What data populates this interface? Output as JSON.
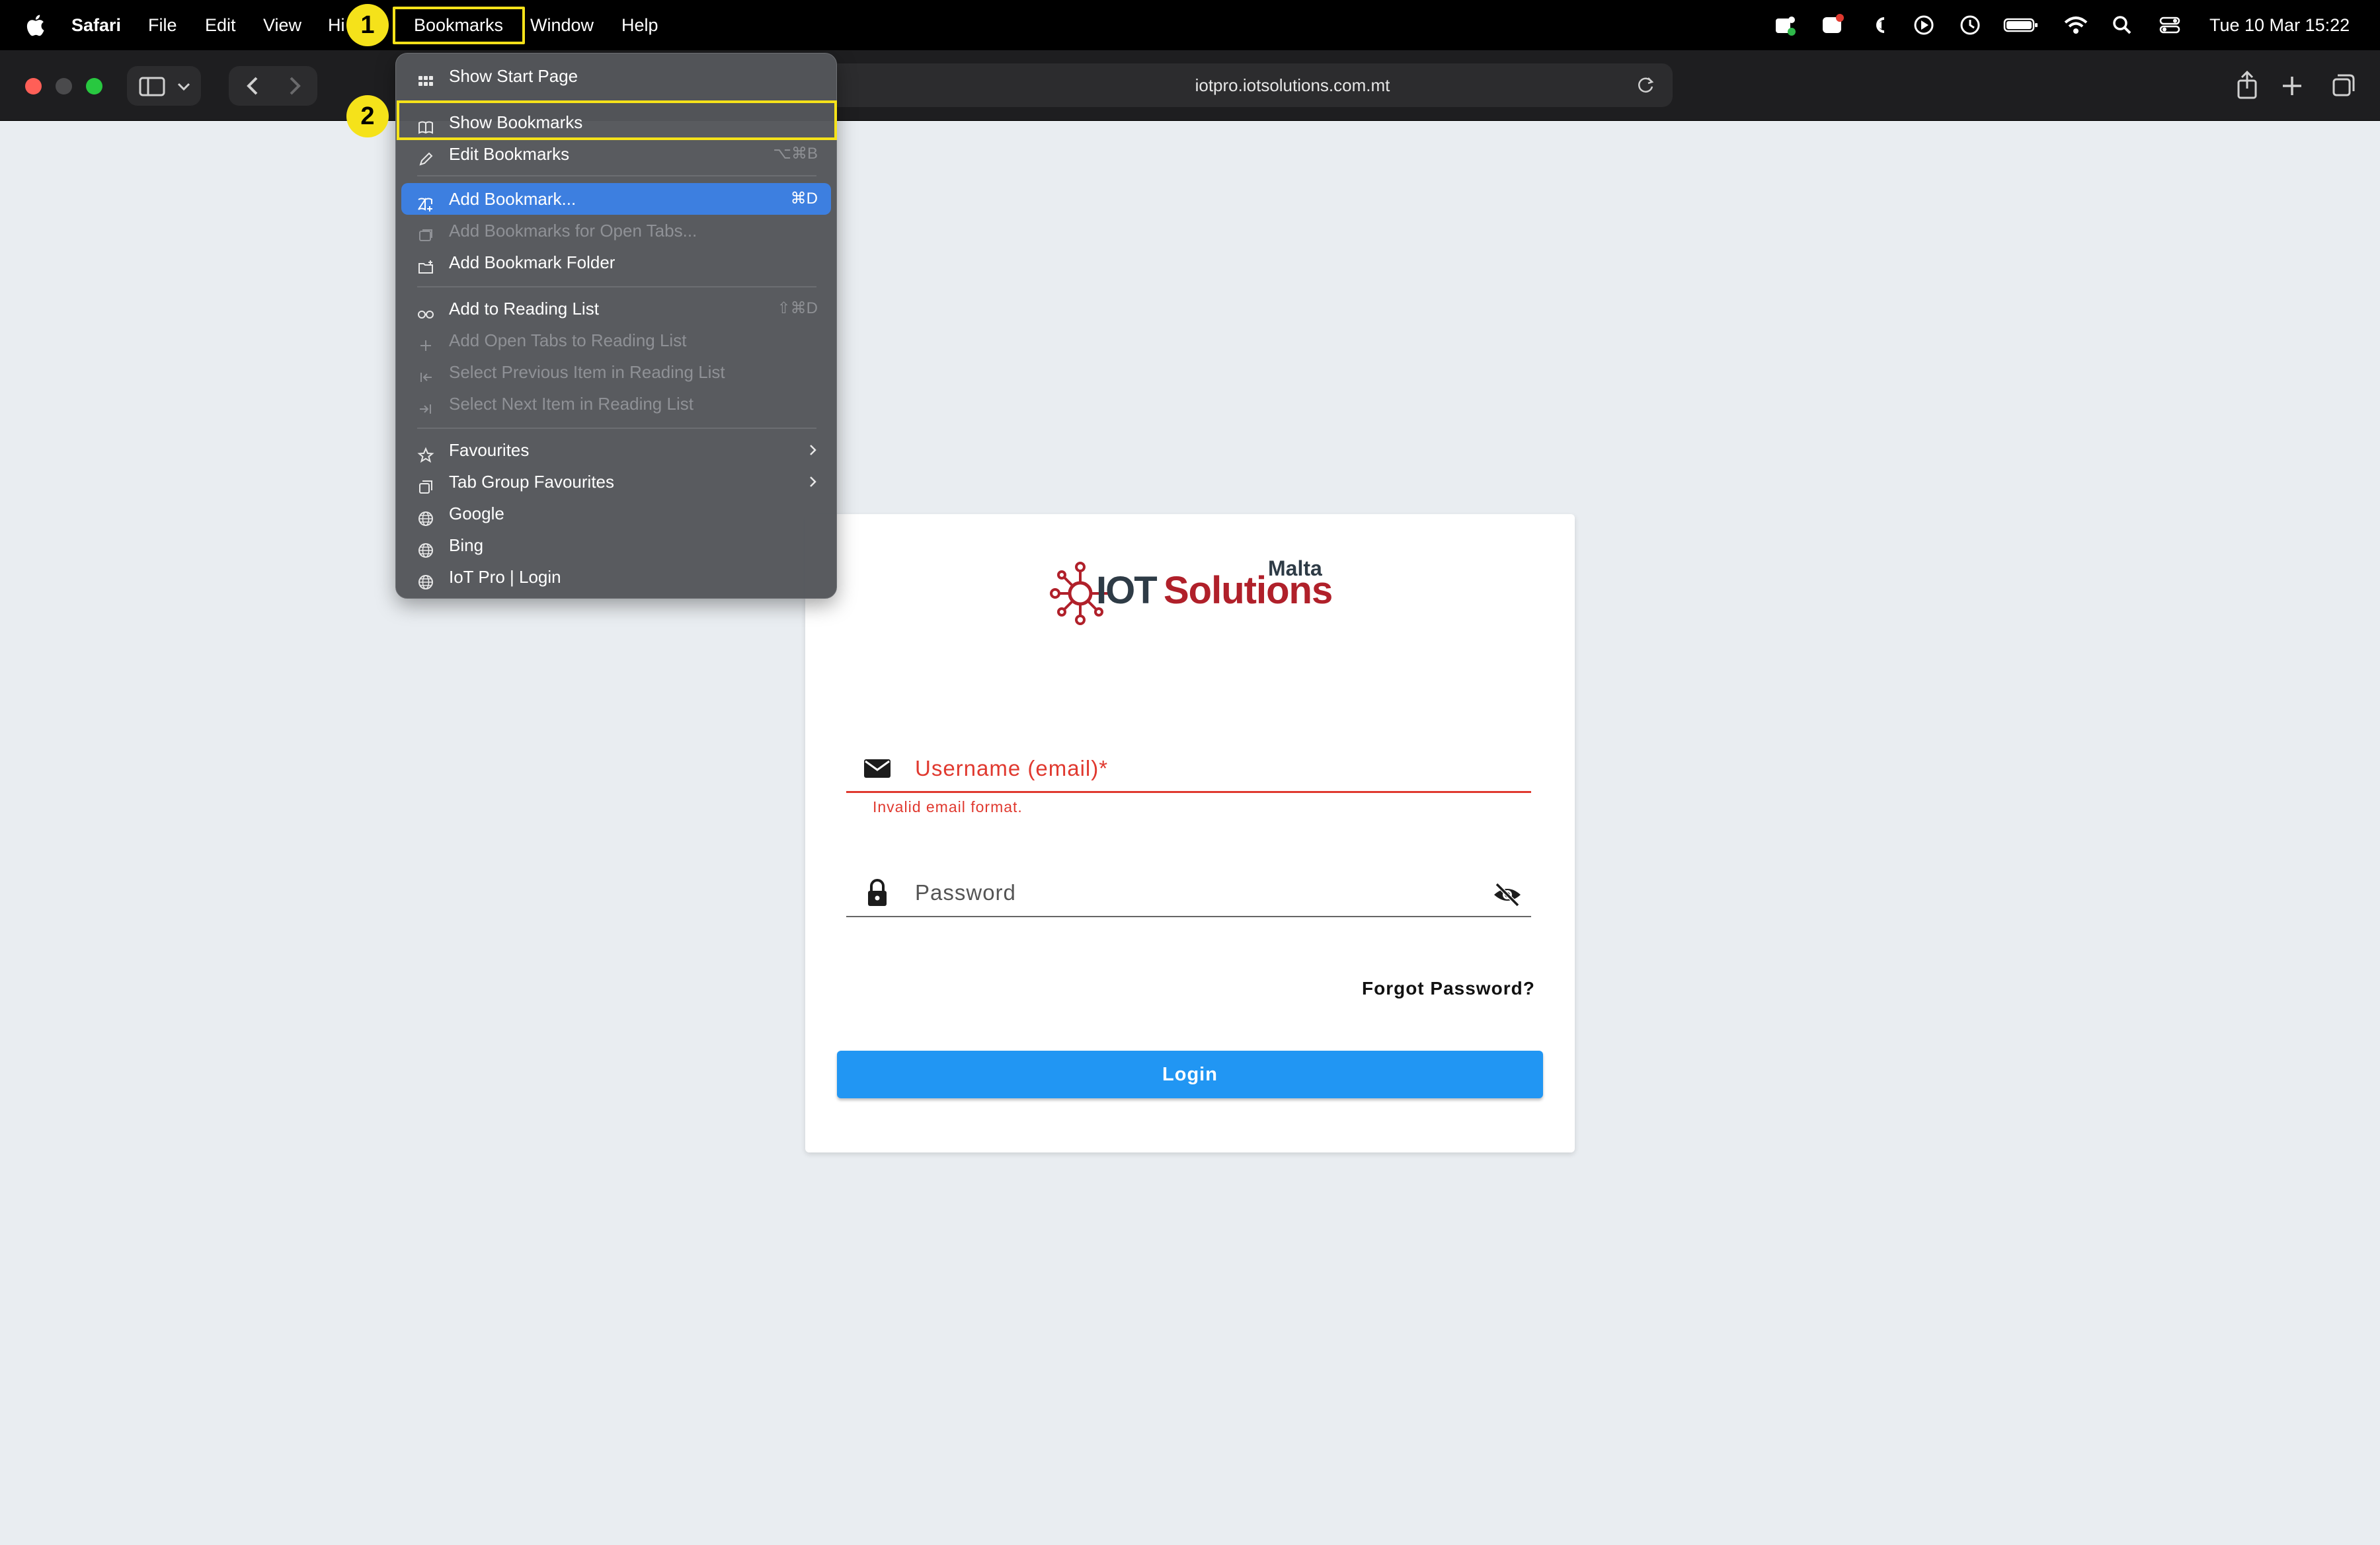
{
  "menubar": {
    "app_name": "Safari",
    "items": [
      "File",
      "Edit",
      "View",
      "Hi",
      "Bookmarks",
      "Window",
      "Help"
    ],
    "clock": "Tue 10 Mar  15:22"
  },
  "toolbar": {
    "address": "iotpro.iotsolutions.com.mt"
  },
  "bookmarks_menu": {
    "items": [
      {
        "label": "Show Start Page",
        "icon": "grid-icon",
        "shortcut": ""
      },
      {
        "label": "Show Bookmarks",
        "icon": "book-icon",
        "shortcut": ""
      },
      {
        "label": "Edit Bookmarks",
        "icon": "pencil-icon",
        "shortcut": "⌥⌘B"
      },
      {
        "label": "Add Bookmark...",
        "icon": "book-plus-icon",
        "shortcut": "⌘D"
      },
      {
        "label": "Add Bookmarks for Open Tabs...",
        "icon": "tabs-bookmark-icon",
        "shortcut": ""
      },
      {
        "label": "Add Bookmark Folder",
        "icon": "folder-plus-icon",
        "shortcut": ""
      },
      {
        "label": "Add to Reading List",
        "icon": "glasses-icon",
        "shortcut": "⇧⌘D"
      },
      {
        "label": "Add Open Tabs to Reading List",
        "icon": "plus-icon",
        "shortcut": ""
      },
      {
        "label": "Select Previous Item in Reading List",
        "icon": "previous-item-icon",
        "shortcut": ""
      },
      {
        "label": "Select Next Item in Reading List",
        "icon": "next-item-icon",
        "shortcut": ""
      },
      {
        "label": "Favourites",
        "icon": "star-icon",
        "shortcut": ""
      },
      {
        "label": "Tab Group Favourites",
        "icon": "tab-group-icon",
        "shortcut": ""
      },
      {
        "label": "Google",
        "icon": "globe-icon",
        "shortcut": ""
      },
      {
        "label": "Bing",
        "icon": "globe-icon",
        "shortcut": ""
      },
      {
        "label": "IoT Pro | Login",
        "icon": "globe-icon",
        "shortcut": ""
      }
    ]
  },
  "steps": [
    "1",
    "2"
  ],
  "login": {
    "logo": {
      "iot": "IOT",
      "solutions": "Solutions",
      "region": "Malta"
    },
    "username_label": "Username (email)*",
    "email_error": "Invalid email format.",
    "password_label": "Password",
    "forgot_password": "Forgot Password?",
    "login_button": "Login"
  },
  "colors": {
    "accent": "#2196f3",
    "error": "#e0392f",
    "highlight": "#f5e21a",
    "menu_selected": "#3d7fe0"
  }
}
